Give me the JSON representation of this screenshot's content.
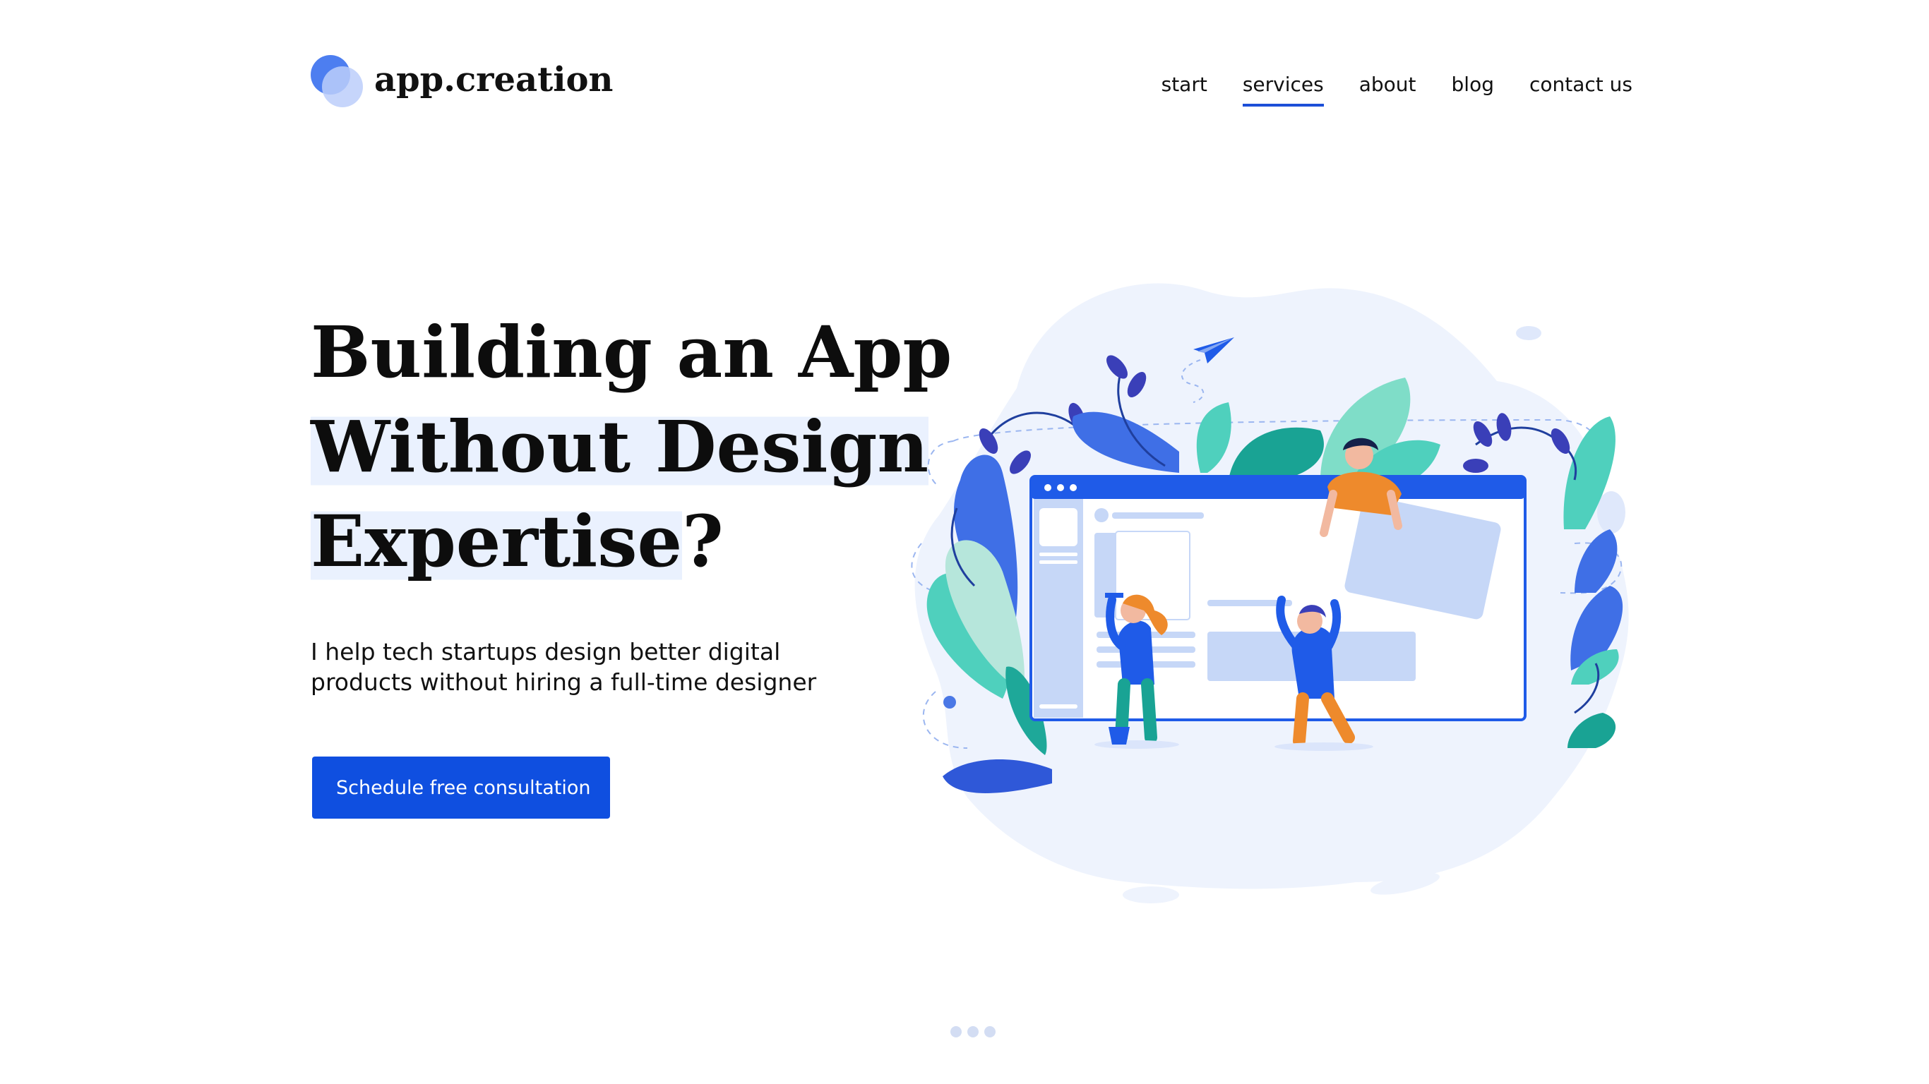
{
  "brand": {
    "name": "app.creation"
  },
  "nav": {
    "items": [
      {
        "label": "start",
        "active": false
      },
      {
        "label": "services",
        "active": true
      },
      {
        "label": "about",
        "active": false
      },
      {
        "label": "blog",
        "active": false
      },
      {
        "label": "contact us",
        "active": false
      }
    ]
  },
  "hero": {
    "headline_lines": [
      "Building an App",
      "Without Design",
      "Expertise",
      "?"
    ],
    "subtitle": "I help tech startups design better digital products without hiring a full-time designer",
    "cta_label": "Schedule free consultation"
  },
  "pager": {
    "dot_count": 3
  },
  "colors": {
    "accent": "#0f4fe0",
    "highlight": "#eaf1fe",
    "text": "#111111"
  }
}
